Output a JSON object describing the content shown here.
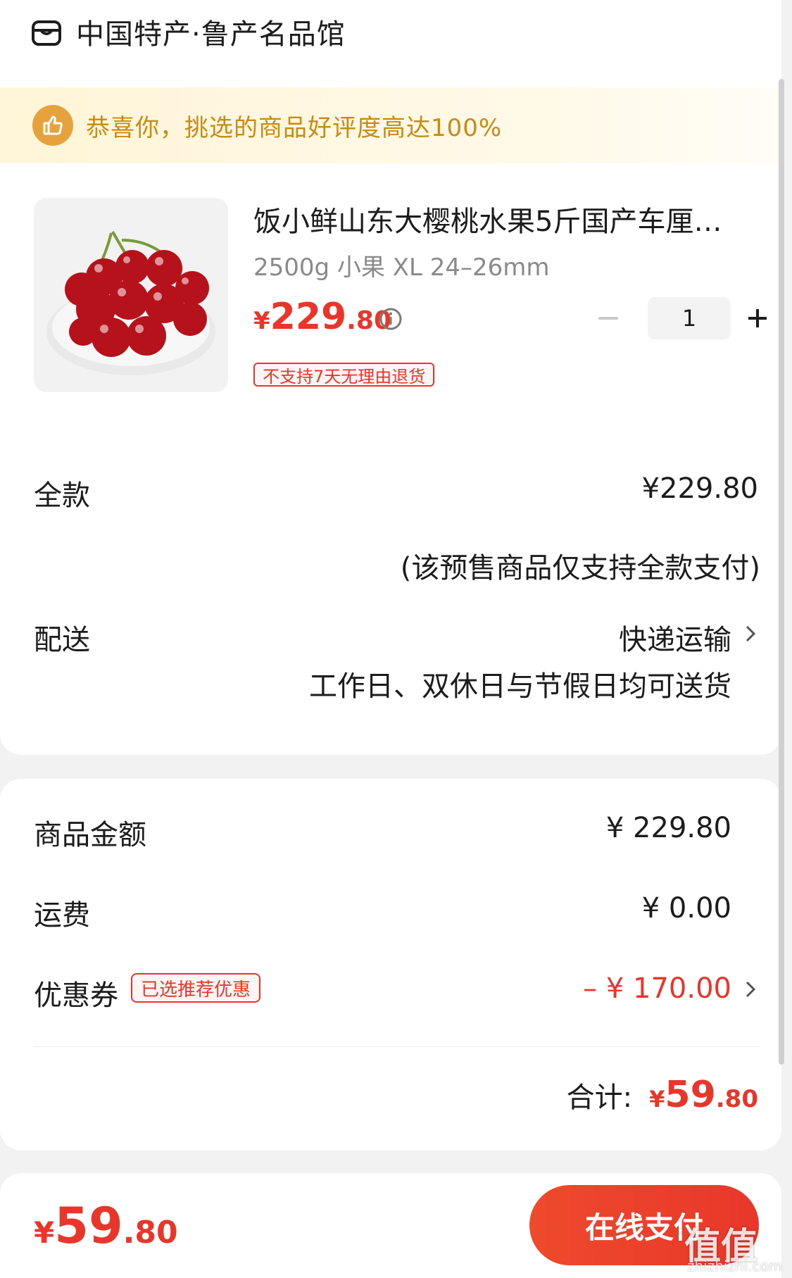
{
  "store": {
    "icon": "shop-icon",
    "name": "中国特产·鲁产名品馆"
  },
  "banner": {
    "icon": "thumbs-up-icon",
    "text": "恭喜你，挑选的商品好评度高达100%"
  },
  "product": {
    "image": "cherries-photo",
    "title": "饭小鲜山东大樱桃水果5斤国产车厘…",
    "spec": "2500g 小果 XL 24–26mm",
    "price": {
      "symbol": "¥",
      "integer": "229",
      "decimal": ".80"
    },
    "info_icon": "info-icon",
    "quantity": "1",
    "minus_icon": "minus-icon",
    "plus_icon": "plus-icon",
    "tag": "不支持7天无理由退货"
  },
  "payment": {
    "label": "全款",
    "value": "¥229.80",
    "note": "(该预售商品仅支持全款支付)"
  },
  "delivery": {
    "label": "配送",
    "method": "快递运输",
    "note": "工作日、双休日与节假日均可送货"
  },
  "summary": {
    "goods_label": "商品金额",
    "goods_value": "¥ 229.80",
    "shipping_label": "运费",
    "shipping_value": "¥ 0.00",
    "coupon_label": "优惠券",
    "coupon_tag": "已选推荐优惠",
    "coupon_value": "– ¥ 170.00",
    "total_label": "合计:",
    "total": {
      "symbol": "¥",
      "integer": "59",
      "decimal": ".80"
    }
  },
  "bottom": {
    "price": {
      "symbol": "¥",
      "integer": "59",
      "decimal": ".80"
    },
    "pay_button": "在线支付"
  },
  "watermark": {
    "text": "值值值",
    "sub": "zhizhizhi.com"
  },
  "colors": {
    "accent": "#e8372a",
    "banner_text": "#c98a12",
    "banner_badge": "#e6a23c"
  }
}
